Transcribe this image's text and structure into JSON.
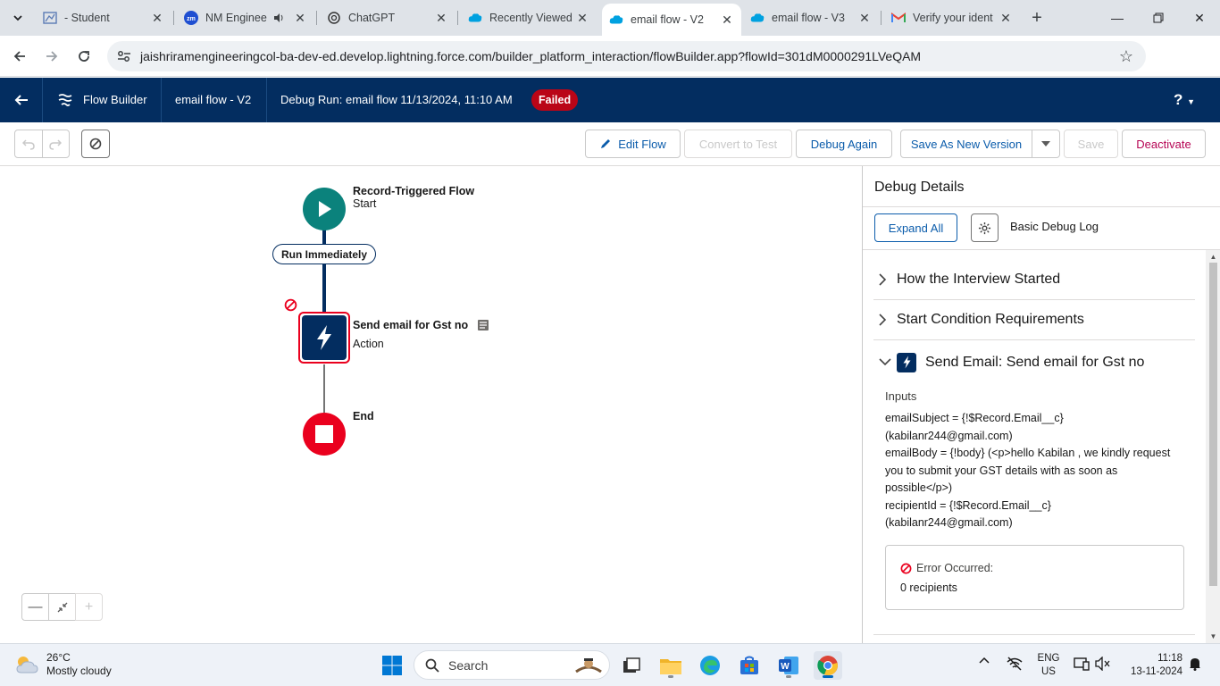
{
  "browser": {
    "tabs": [
      {
        "title": "- Student",
        "icon": "student-portal-icon"
      },
      {
        "title": "NM Enginee",
        "icon": "zm-icon",
        "audio": true
      },
      {
        "title": "ChatGPT",
        "icon": "chatgpt-icon"
      },
      {
        "title": "Recently Viewed",
        "icon": "salesforce-cloud-icon"
      },
      {
        "title": "email flow - V2",
        "icon": "salesforce-cloud-icon",
        "active": true
      },
      {
        "title": "email flow - V3",
        "icon": "salesforce-cloud-icon"
      },
      {
        "title": "Verify your ident",
        "icon": "gmail-icon"
      }
    ],
    "url": "jaishriramengineeringcol-ba-dev-ed.develop.lightning.force.com/builder_platform_interaction/flowBuilder.app?flowId=301dM0000291LVeQAM"
  },
  "header": {
    "app_name": "Flow Builder",
    "flow_name": "email flow - V2",
    "debug_run": "Debug Run: email flow 11/13/2024, 11:10 AM",
    "status_badge": "Failed",
    "help": "?"
  },
  "toolbar": {
    "edit_flow": "Edit Flow",
    "convert_to_test": "Convert to Test",
    "debug_again": "Debug Again",
    "save_as_new_version": "Save As New Version",
    "save": "Save",
    "deactivate": "Deactivate"
  },
  "canvas": {
    "start": {
      "title": "Record-Triggered Flow",
      "subtitle": "Start"
    },
    "run_immediately": "Run Immediately",
    "action": {
      "title": "Send email for Gst no",
      "subtitle": "Action"
    },
    "end": {
      "title": "End"
    }
  },
  "debug_panel": {
    "title": "Debug Details",
    "expand_all": "Expand All",
    "log_level": "Basic Debug Log",
    "sections": [
      {
        "label": "How the Interview Started",
        "expanded": false
      },
      {
        "label": "Start Condition Requirements",
        "expanded": false
      },
      {
        "label": "Send Email: Send email for Gst no",
        "expanded": true
      }
    ],
    "inputs_heading": "Inputs",
    "inputs_lines": [
      "emailSubject = {!$Record.Email__c}",
      "(kabilanr244@gmail.com)",
      "emailBody = {!body} (<p>hello Kabilan , we kindly request",
      "you to submit your GST details with as soon as",
      "possible</p>)",
      "recipientId = {!$Record.Email__c}",
      "(kabilanr244@gmail.com)"
    ],
    "error_heading": "Error Occurred:",
    "error_message": "0 recipients"
  },
  "taskbar": {
    "temperature": "26°C",
    "weather": "Mostly cloudy",
    "search_label": "Search",
    "lang_top": "ENG",
    "lang_bottom": "US",
    "time": "11:18",
    "date": "13-11-2024"
  },
  "colors": {
    "sf_navy": "#032d60",
    "start_teal": "#0b827c",
    "end_red": "#ea001e",
    "failed_red": "#ba0517",
    "link_blue": "#0b5cab"
  }
}
